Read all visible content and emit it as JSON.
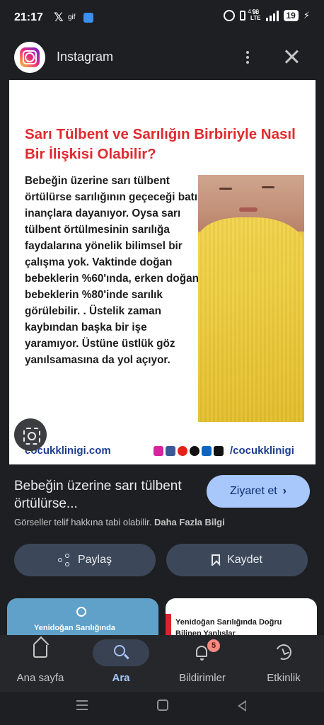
{
  "status_bar": {
    "time": "21:17",
    "x_glyph": "𝕏",
    "gif_label": "gif",
    "network_label": "Vo\nLTE",
    "speed": "4.50",
    "battery": "19"
  },
  "header": {
    "app_name": "Instagram"
  },
  "post": {
    "title": "Sarı Tülbent ve Sarılığın Birbiriyle Nasıl Bir İlişkisi Olabilir?",
    "body": "Bebeğin üzerine sarı tülbent örtülürse sarılığının geçeceği batıl inançlara dayanıyor. Oysa sarı tülbent örtülmesinin sarılığa faydalarına yönelik bilimsel bir çalışma yok. Vaktinde doğan bebeklerin %60'ında, erken doğan bebeklerin %80'inde sarılık görülebilir. . Üstelik zaman kaybından başka bir işe yaramıyor. Üstüne üstlük göz yanılsamasına da yol açıyor.",
    "site": "cocukklinigi.com",
    "handle": "/cocukklinigi",
    "social_icons": [
      {
        "name": "instagram-icon",
        "color": "#d6249f"
      },
      {
        "name": "facebook-icon",
        "color": "#3b5998"
      },
      {
        "name": "youtube-icon",
        "color": "#e62117"
      },
      {
        "name": "x-icon",
        "color": "#111111"
      },
      {
        "name": "linkedin-icon",
        "color": "#0a66c2"
      },
      {
        "name": "tiktok-icon",
        "color": "#111111"
      }
    ]
  },
  "info": {
    "title": "Bebeğin üzerine sarı tülbent örtülürse...",
    "visit_label": "Ziyaret et",
    "copyright_text": "Görseller telif hakkına tabi olabilir.",
    "more_info_link": "Daha Fazla Bilgi"
  },
  "actions": {
    "share_label": "Paylaş",
    "save_label": "Kaydet"
  },
  "related": [
    {
      "title": "Yenidoğan Sarılığında"
    },
    {
      "title": "Yenidoğan Sarılığında Doğru Bilinen Yanlışlar"
    }
  ],
  "nav": {
    "items": [
      {
        "label": "Ana sayfa",
        "active": false
      },
      {
        "label": "Ara",
        "active": true
      },
      {
        "label": "Bildirimler",
        "active": false,
        "badge": "5"
      },
      {
        "label": "Etkinlik",
        "active": false
      }
    ]
  },
  "colors": {
    "background": "#1e1f22",
    "accent": "#a8c7fa",
    "post_title": "#e02a2f",
    "post_link": "#1d3f8f"
  }
}
